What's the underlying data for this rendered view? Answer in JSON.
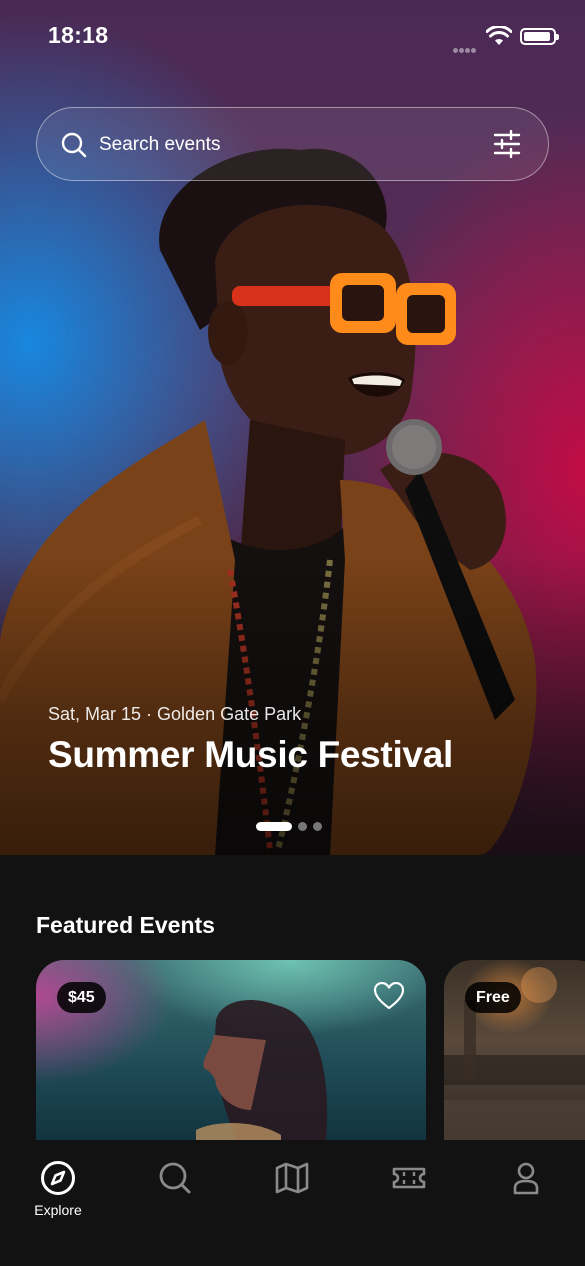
{
  "status_bar": {
    "time": "18:18"
  },
  "search": {
    "placeholder": "Search events"
  },
  "hero": {
    "meta": "Sat, Mar 15 · Golden Gate Park",
    "title": "Summer Music Festival",
    "pager": {
      "total": 3,
      "active": 1
    }
  },
  "featured": {
    "title": "Featured Events",
    "cards": [
      {
        "price": "$45",
        "favorite": false
      },
      {
        "price": "Free"
      }
    ]
  },
  "tabs": [
    {
      "icon": "compass-icon",
      "label": "Explore",
      "active": true
    },
    {
      "icon": "search-icon",
      "label": ""
    },
    {
      "icon": "map-icon",
      "label": ""
    },
    {
      "icon": "ticket-icon",
      "label": ""
    },
    {
      "icon": "profile-icon",
      "label": ""
    }
  ],
  "colors": {
    "background": "#121212",
    "active_tab": "#ffffff",
    "inactive_tab": "#8a8a8a"
  }
}
